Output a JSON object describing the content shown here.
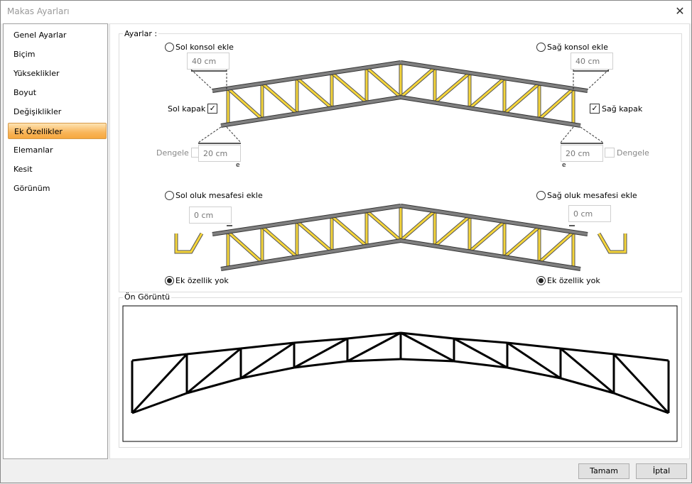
{
  "window": {
    "title": "Makas Ayarları",
    "close_icon": "close-icon"
  },
  "sidebar": {
    "items": [
      {
        "label": "Genel Ayarlar"
      },
      {
        "label": "Biçim"
      },
      {
        "label": "Yükseklikler"
      },
      {
        "label": "Boyut"
      },
      {
        "label": "Değişiklikler"
      },
      {
        "label": "Ek Özellikler",
        "active": true
      },
      {
        "label": "Elemanlar"
      },
      {
        "label": "Kesit"
      },
      {
        "label": "Görünüm"
      }
    ]
  },
  "settings": {
    "label": "Ayarlar :",
    "left_console": {
      "label": "Sol konsol ekle",
      "selected": false,
      "value": "40 cm"
    },
    "right_console": {
      "label": "Sağ konsol ekle",
      "selected": false,
      "value": "40 cm"
    },
    "left_cap": {
      "label": "Sol kapak",
      "checked": true
    },
    "right_cap": {
      "label": "Sağ kapak",
      "checked": true
    },
    "left_balance": {
      "label": "Dengele",
      "checked": false,
      "value": "20 cm",
      "sub": "e"
    },
    "right_balance": {
      "label": "Dengele",
      "checked": false,
      "value": "20 cm",
      "sub": "e"
    },
    "left_gutter": {
      "label": "Sol oluk mesafesi ekle",
      "selected": false,
      "value": "0 cm"
    },
    "right_gutter": {
      "label": "Sağ oluk mesafesi ekle",
      "selected": false,
      "value": "0 cm"
    },
    "left_none": {
      "label": "Ek özellik yok",
      "selected": true
    },
    "right_none": {
      "label": "Ek özellik yok",
      "selected": true
    },
    "colors": {
      "chord": "#808080",
      "web": "#f5d53a"
    }
  },
  "preview": {
    "label": "Ön Görüntü"
  },
  "buttons": {
    "ok": "Tamam",
    "cancel": "İptal"
  }
}
